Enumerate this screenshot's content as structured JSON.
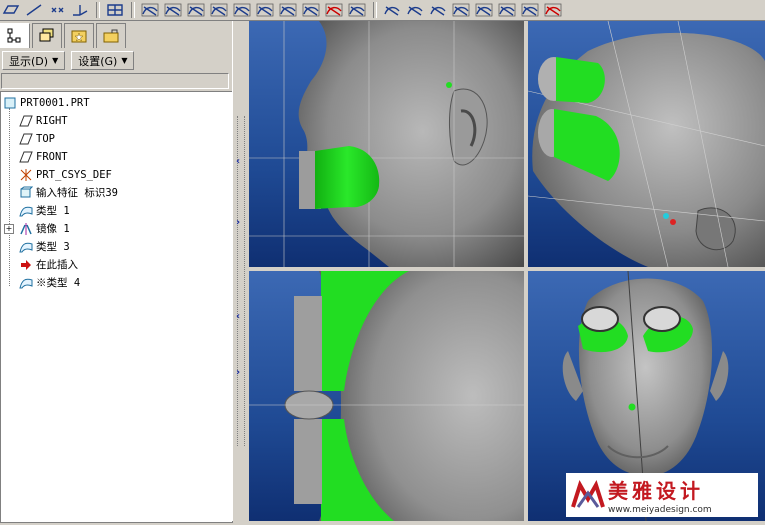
{
  "toolbar": {
    "groups": [
      [
        "datum-plane-icon",
        "datum-axis-icon",
        "datum-point-icon",
        "datum-csys-icon"
      ],
      [
        "repaint-icon"
      ],
      [
        "view-orient-icon",
        "view-shade-icon",
        "view-wire-icon",
        "view-hidden-icon",
        "view-nohidden-icon",
        "view-perspective-icon",
        "view-saved-icon",
        "view-spin-icon",
        "view-delete-icon",
        "view-refit-icon"
      ],
      [
        "what-this-icon",
        "measure-icon",
        "ruler-icon",
        "analysis-icon",
        "surface-icon",
        "curvature-icon",
        "reflection-icon",
        "analysis-delete-icon"
      ]
    ]
  },
  "panel": {
    "tabs": [
      "model-tree-tab",
      "layer-tab",
      "favorites-tab",
      "connections-tab"
    ],
    "display_menu": "显示(D)",
    "settings_menu": "设置(G)"
  },
  "tree": {
    "items": [
      {
        "label": "PRT0001.PRT",
        "icon": "part-icon",
        "level": 0
      },
      {
        "label": "RIGHT",
        "icon": "datum-plane-icon",
        "level": 1
      },
      {
        "label": "TOP",
        "icon": "datum-plane-icon",
        "level": 1
      },
      {
        "label": "FRONT",
        "icon": "datum-plane-icon",
        "level": 1
      },
      {
        "label": "PRT_CSYS_DEF",
        "icon": "csys-icon",
        "level": 1
      },
      {
        "label": "输入特征 标识39",
        "icon": "import-feature-icon",
        "level": 1
      },
      {
        "label": "类型 1",
        "icon": "surface-feature-icon",
        "level": 1
      },
      {
        "label": "镜像 1",
        "icon": "mirror-icon",
        "level": 1
      },
      {
        "label": "类型 3",
        "icon": "surface-feature-icon",
        "level": 1
      },
      {
        "label": "在此插入",
        "icon": "insert-here-icon",
        "level": 1
      },
      {
        "label": "※类型 4",
        "icon": "surface-feature-icon",
        "level": 1
      }
    ]
  },
  "colors": {
    "viewport_top": "#3c69b4",
    "viewport_bottom": "#0f2f72",
    "green_feature": "#22dd22",
    "model_gray": "#8a8a8a",
    "insert_arrow": "#cc1111"
  },
  "watermark": {
    "text": "美雅设计",
    "url": "www.meiyadesign.com"
  }
}
